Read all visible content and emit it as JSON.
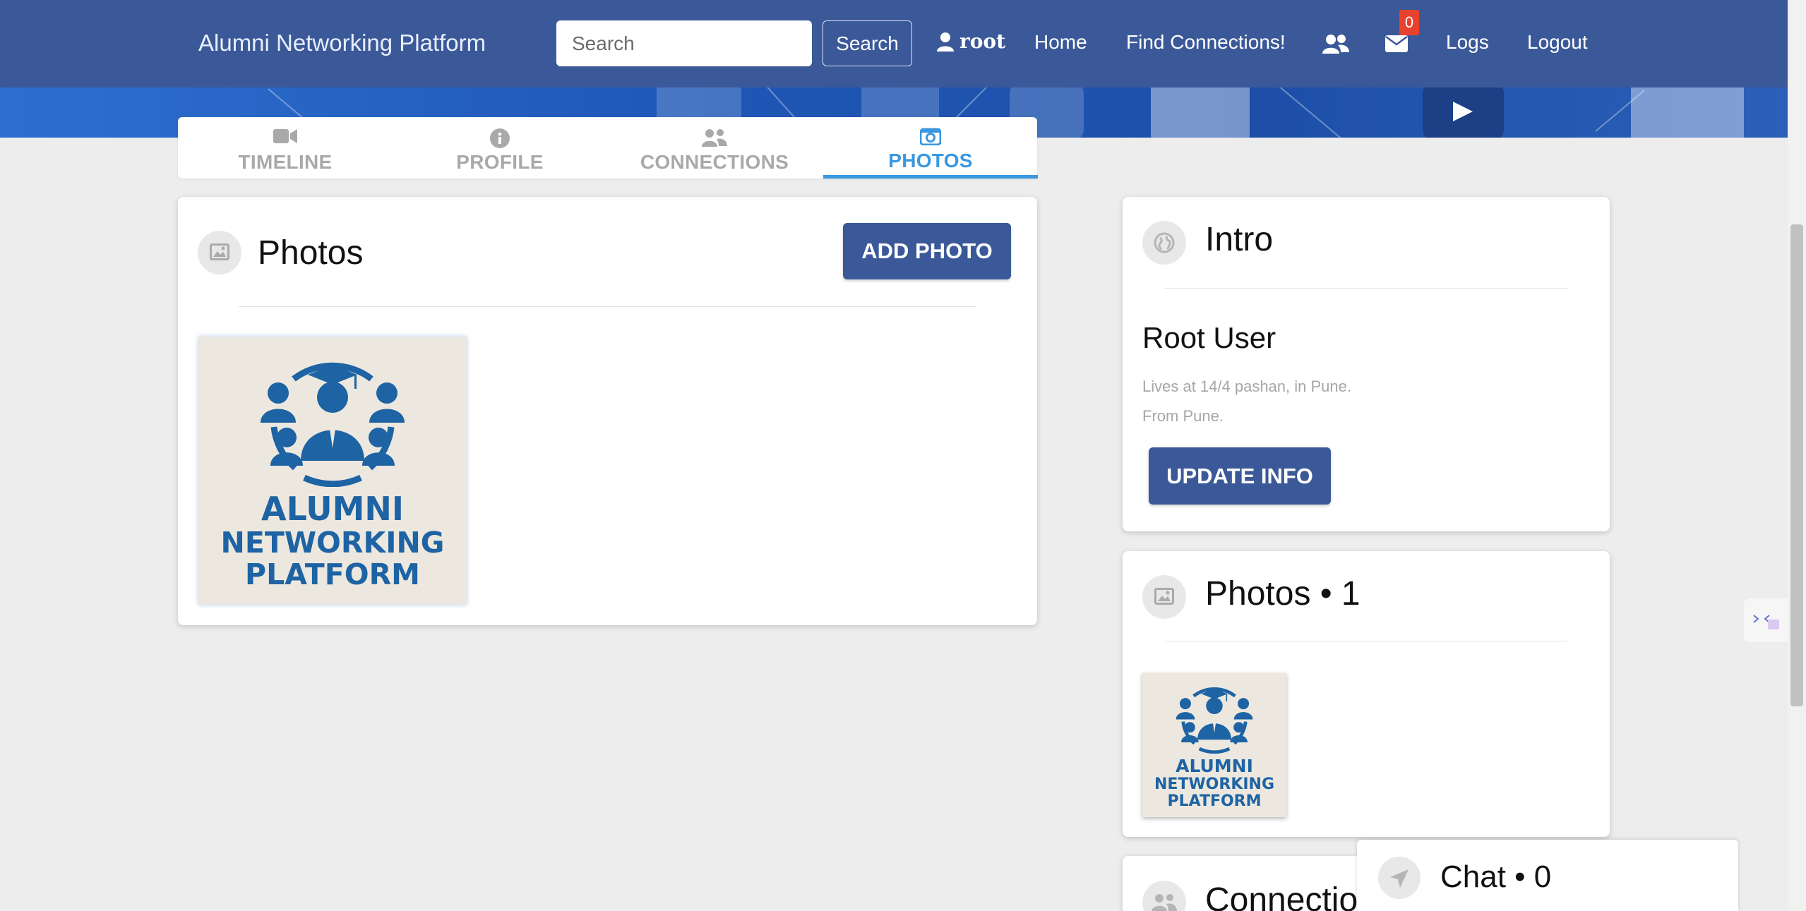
{
  "navbar": {
    "brand": "Alumni Networking Platform",
    "search_placeholder": "Search",
    "search_button": "Search",
    "user": "root",
    "home": "Home",
    "find_connections": "Find Connections!",
    "messages_badge": "0",
    "logs": "Logs",
    "logout": "Logout",
    "icons": [
      "user-icon",
      "friends-icon",
      "envelope-icon"
    ]
  },
  "tabs": [
    {
      "label": "TIMELINE",
      "icon": "video-camera-icon",
      "active": false
    },
    {
      "label": "PROFILE",
      "icon": "info-circle-icon",
      "active": false
    },
    {
      "label": "CONNECTIONS",
      "icon": "users-icon",
      "active": false
    },
    {
      "label": "PHOTOS",
      "icon": "camera-icon",
      "active": true
    }
  ],
  "photos_card": {
    "title": "Photos",
    "add_button": "ADD PHOTO",
    "photo": {
      "line1": "ALUMNI",
      "line2": "NETWORKING",
      "line3": "PLATFORM"
    }
  },
  "intro_card": {
    "title": "Intro",
    "name": "Root User",
    "lives": "Lives at 14/4 pashan, in Pune.",
    "from": "From Pune.",
    "update_button": "UPDATE INFO"
  },
  "side_photos_card": {
    "title": "Photos • 1",
    "photo": {
      "line1": "ALUMNI",
      "line2": "NETWORKING",
      "line3": "PLATFORM"
    }
  },
  "connections_card": {
    "title": "Connections"
  },
  "chat": {
    "label": "Chat • 0"
  },
  "colors": {
    "navbar": "#3b5998",
    "accent": "#3a98e0",
    "button": "#3b5998",
    "badge": "#e8412c",
    "logo_blue": "#1e63a3"
  }
}
